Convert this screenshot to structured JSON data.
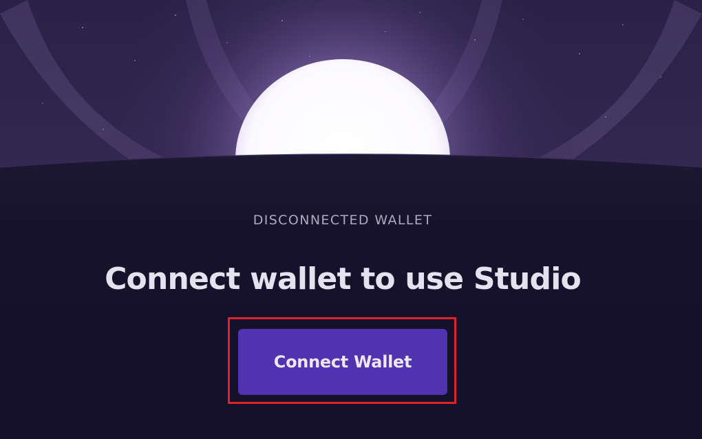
{
  "status_label": "DISCONNECTED WALLET",
  "headline": "Connect wallet to use Studio",
  "connect_button_label": "Connect Wallet",
  "colors": {
    "background": "#15112a",
    "sky_top": "#2a2246",
    "glow": "#8d73b8",
    "sun": "#ffffff",
    "button": "#5133b0",
    "highlight_border": "#e0232a"
  }
}
